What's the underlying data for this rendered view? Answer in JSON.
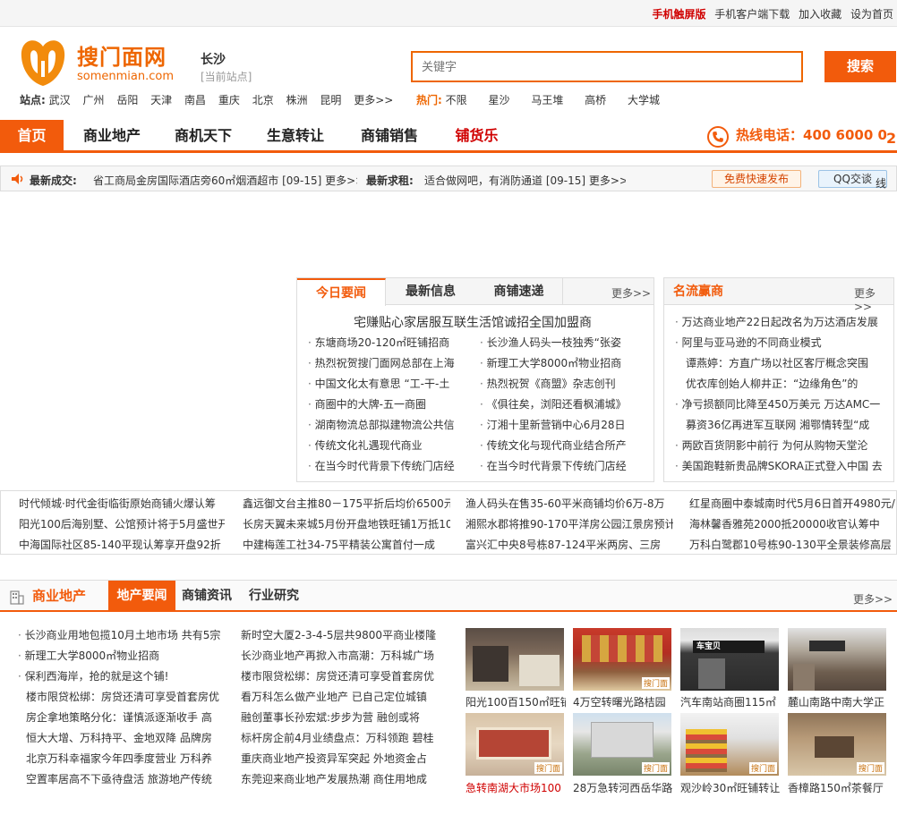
{
  "topbar": {
    "mobile": "手机触屏版",
    "client": "手机客户端下载",
    "favorite": "加入收藏",
    "homepage": "设为首页"
  },
  "header": {
    "logo_text": "搜门面网",
    "logo_sub": "somenmian.com",
    "city": "长沙",
    "city_sub": "[当前站点]",
    "search_placeholder": "关键字",
    "search_button": "搜索"
  },
  "stations": {
    "label": "站点:",
    "items": [
      "武汉",
      "广州",
      "岳阳",
      "天津",
      "南昌",
      "重庆",
      "北京",
      "株洲",
      "昆明",
      "更多>>"
    ]
  },
  "hot": {
    "label": "热门:",
    "items": [
      "不限",
      "星沙",
      "马王堆",
      "高桥",
      "大学城"
    ]
  },
  "nav": {
    "items": [
      "首页",
      "商业地产",
      "商机天下",
      "生意转让",
      "商铺销售",
      "铺货乐"
    ],
    "hotline": "热线电话：400 6000 0",
    "hotline_tail": "2"
  },
  "ticker": {
    "deal_label": "最新成交:",
    "deal_text": "省工商局金房国际酒店旁60㎡烟酒超市 [09-15] 更多>>",
    "rent_label": "最新求租:",
    "rent_text": "适合做网吧，有消防通道 [09-15] 更多>>",
    "free_publish": "免费快速发布",
    "qq": "QQ交谈",
    "qq_tail": "线"
  },
  "news": {
    "tabs": [
      "今日要闻",
      "最新信息",
      "商铺速递"
    ],
    "more": "更多>>",
    "headline": "宅赚贴心家居服互联生活馆诚招全国加盟商",
    "left": [
      "东塘商场20-120㎡旺铺招商",
      "热烈祝贺搜门面网总部在上海",
      "中国文化太有意思 “工-干-土",
      "商圈中的大牌-五一商圈",
      "湖南物流总部拟建物流公共信",
      "传统文化礼遇现代商业",
      "在当今时代背景下传统门店经"
    ],
    "right": [
      "长沙渔人码头一枝独秀“张姿",
      "新理工大学8000㎡物业招商",
      "热烈祝贺《商盟》杂志创刊",
      "《俱往矣，浏阳还看枫浦城》",
      "汀湘十里新营销中心6月28日",
      "传统文化与现代商业结合所产",
      "在当今时代背景下传统门店经"
    ]
  },
  "famous": {
    "title": "名流赢商",
    "more": "更多>>",
    "items": [
      {
        "dot": true,
        "text": "万达商业地产22日起改名为万达酒店发展"
      },
      {
        "dot": true,
        "text": "阿里与亚马逊的不同商业模式"
      },
      {
        "dot": false,
        "text": "谭燕婷：方直广场以社区客厅概念突围"
      },
      {
        "dot": false,
        "text": "优衣库创始人柳井正：“边缘角色”的"
      },
      {
        "dot": true,
        "text": "净亏损额同比降至450万美元 万达AMC一"
      },
      {
        "dot": false,
        "text": "募资36亿再进军互联网 湘鄂情转型“成"
      },
      {
        "dot": true,
        "text": "两欧百货阴影中前行 为何从购物天堂沦"
      },
      {
        "dot": true,
        "text": "美国跑鞋新贵品牌SKORA正式登入中国 去"
      }
    ]
  },
  "properties": {
    "col1": [
      "时代倾城·时代金街临街原始商铺火爆认筹",
      "阳光100后海别墅、公馆预计将于5月盛世开",
      "中海国际社区85-140平现认筹享开盘92折"
    ],
    "col2": [
      "鑫远御文台主推80－175平折后均价6500元/",
      "长房天翼未来城5月份开盘地铁旺铺1万抵10",
      "中建梅莲工社34-75平精装公寓首付一成"
    ],
    "col3": [
      "渔人码头在售35-60平米商铺均价6万-8万",
      "湘熙水郡将推90-170平洋房公园江景房预计",
      "富兴汇中央8号栋87-124平米两房、三房"
    ],
    "col4": [
      "红星商圈中泰城南时代5月6日首开4980元/",
      "海林馨香雅苑2000抵20000收官认筹中",
      "万科白鹭郡10号栋90-130平全景装修高层"
    ]
  },
  "section": {
    "title": "商业地产",
    "tabs": [
      "地产要闻",
      "商铺资讯",
      "行业研究"
    ],
    "more": "更多>>",
    "col1": [
      "长沙商业用地包揽10月土地市场 共有5宗",
      "新理工大学8000㎡物业招商",
      "保利西海岸，抢的就是这个铺!",
      "楼市限贷松绑：房贷还清可享受首套房优",
      "房企拿地策略分化：谨慎派逐渐收手 高",
      "恒大大增、万科持平、金地双降 品牌房",
      "北京万科幸福家今年四季度营业 万科养",
      "空置率居高不下亟待盘活 旅游地产传统"
    ],
    "col2": [
      "新时空大厦2-3-4-5层共9800平商业楼隆",
      "长沙商业地产再掀入市高潮：万科城广场",
      "楼市限贷松绑：房贷还清可享受首套房优",
      "看万科怎么做产业地产 已自己定位城镇",
      "融创董事长孙宏斌:步步为营 融创或将",
      "标杆房企前4月业绩盘点：万科领跑 碧桂",
      "重庆商业地产投资异军突起 外地资金占",
      "东莞迎来商业地产发展热潮 商住用地成"
    ],
    "photos": [
      {
        "caption": "阳光100百150㎡旺铺",
        "red": false,
        "logo": ""
      },
      {
        "caption": "4万空转曙光路桔园",
        "red": false,
        "logo": "搜门面"
      },
      {
        "caption": "汽车南站商圈115㎡",
        "red": false,
        "logo": "车宝贝"
      },
      {
        "caption": "麓山南路中南大学正",
        "red": false,
        "logo": ""
      },
      {
        "caption": "急转南湖大市场100",
        "red": true,
        "logo": "搜门面"
      },
      {
        "caption": "28万急转河西岳华路",
        "red": false,
        "logo": "搜门面"
      },
      {
        "caption": "观沙岭30㎡旺铺转让",
        "red": false,
        "logo": "搜门面"
      },
      {
        "caption": "香樟路150㎡茶餐厅",
        "red": false,
        "logo": "搜门面"
      }
    ]
  },
  "colors": {
    "brand": "#f25b0c",
    "red": "#d00000"
  }
}
